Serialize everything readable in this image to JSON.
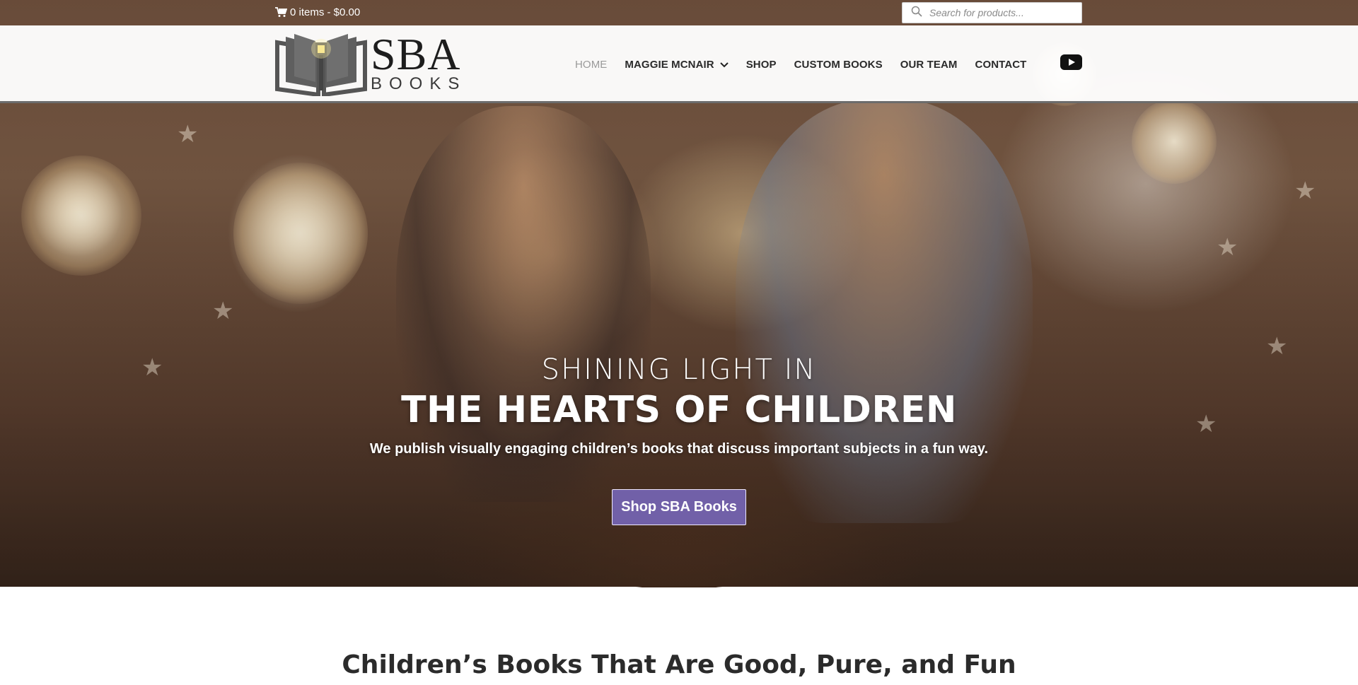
{
  "topbar": {
    "cart_text": "0 items - $0.00",
    "search_placeholder": "Search for products..."
  },
  "header": {
    "logo_title": "SBA",
    "logo_subtitle": "BOOKS",
    "nav": [
      {
        "label": "HOME",
        "active": true
      },
      {
        "label": "MAGGIE MCNAIR",
        "has_dropdown": true
      },
      {
        "label": "SHOP"
      },
      {
        "label": "CUSTOM BOOKS"
      },
      {
        "label": "OUR TEAM"
      },
      {
        "label": "CONTACT"
      }
    ],
    "social_icon": "youtube-icon"
  },
  "hero": {
    "kicker": "SHINING LIGHT IN",
    "headline": "THE HEARTS OF CHILDREN",
    "subtitle": "We publish visually engaging children’s books that discuss important subjects in a fun way.",
    "cta_label": "Shop SBA Books"
  },
  "section": {
    "title": "Children’s Books That Are Good, Pure, and Fun"
  },
  "colors": {
    "accent": "#7160a8",
    "nav_text": "#2a2a2a",
    "nav_active": "#9a9a9a"
  }
}
